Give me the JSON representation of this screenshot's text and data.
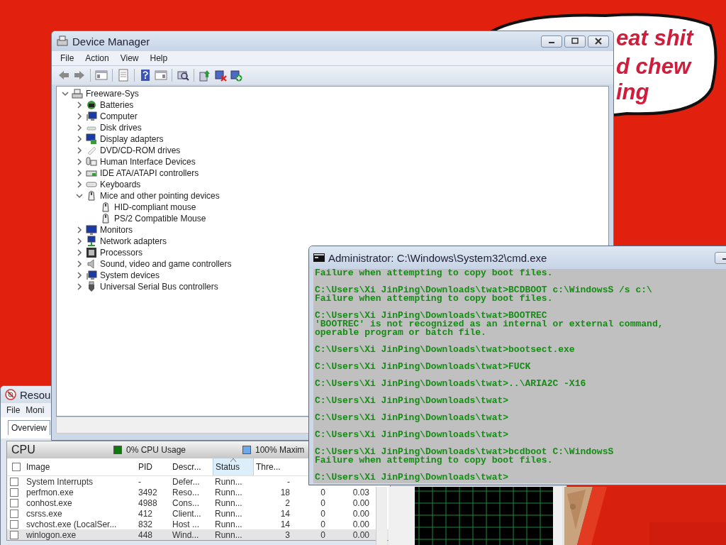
{
  "speech_bubble": {
    "lines": [
      "eat shit",
      "d chew",
      "ing"
    ]
  },
  "resource_monitor": {
    "title": "Resou",
    "menu": [
      "File",
      "Moni"
    ],
    "tabs": [
      {
        "label": "Overview",
        "selected": true
      }
    ],
    "cpu_panel": {
      "title": "CPU",
      "all_checked": false,
      "legend": [
        {
          "label": "0% CPU Usage",
          "color": "#0e7a0e"
        },
        {
          "label": "100% Maxim",
          "color": "#6aa8f0"
        }
      ],
      "columns": [
        {
          "label": "Image",
          "sorted": false
        },
        {
          "label": "PID",
          "sorted": false
        },
        {
          "label": "Descr...",
          "sorted": false
        },
        {
          "label": "Status",
          "sorted": true
        },
        {
          "label": "Thre...",
          "sorted": false
        }
      ],
      "rows": [
        {
          "checked": false,
          "selected": false,
          "cells": [
            "System Interrupts",
            "-",
            "Defer...",
            "Runn...",
            "-"
          ]
        },
        {
          "checked": false,
          "selected": false,
          "cells": [
            "perfmon.exe",
            "3492",
            "Reso...",
            "Runn...",
            "18",
            "0",
            "0.03"
          ]
        },
        {
          "checked": false,
          "selected": false,
          "cells": [
            "conhost.exe",
            "4988",
            "Cons...",
            "Runn...",
            "2",
            "0",
            "0.00"
          ]
        },
        {
          "checked": false,
          "selected": false,
          "cells": [
            "csrss.exe",
            "412",
            "Client...",
            "Runn...",
            "14",
            "0",
            "0.00"
          ]
        },
        {
          "checked": false,
          "selected": false,
          "cells": [
            "svchost.exe (LocalSer...",
            "832",
            "Host ...",
            "Runn...",
            "14",
            "0",
            "0.00"
          ]
        },
        {
          "checked": false,
          "selected": true,
          "cells": [
            "winlogon.exe",
            "448",
            "Wind...",
            "Runn...",
            "3",
            "0",
            "0.00"
          ]
        }
      ]
    }
  },
  "device_manager": {
    "title": "Device Manager",
    "menu": [
      "File",
      "Action",
      "View",
      "Help"
    ],
    "tree": [
      {
        "label": "Freeware-Sys",
        "kind": "host",
        "expanded": true,
        "children": [
          {
            "label": "Batteries",
            "kind": "battery",
            "expanded": false
          },
          {
            "label": "Computer",
            "kind": "computer",
            "expanded": false
          },
          {
            "label": "Disk drives",
            "kind": "disk",
            "expanded": false
          },
          {
            "label": "Display adapters",
            "kind": "display",
            "expanded": false
          },
          {
            "label": "DVD/CD-ROM drives",
            "kind": "dvd",
            "expanded": false
          },
          {
            "label": "Human Interface Devices",
            "kind": "hid",
            "expanded": false
          },
          {
            "label": "IDE ATA/ATAPI controllers",
            "kind": "ide",
            "expanded": false
          },
          {
            "label": "Keyboards",
            "kind": "keyboard",
            "expanded": false
          },
          {
            "label": "Mice and other pointing devices",
            "kind": "mouse",
            "expanded": true,
            "children": [
              {
                "label": "HID-compliant mouse",
                "kind": "mouse"
              },
              {
                "label": "PS/2 Compatible Mouse",
                "kind": "mouse"
              }
            ]
          },
          {
            "label": "Monitors",
            "kind": "monitor",
            "expanded": false
          },
          {
            "label": "Network adapters",
            "kind": "network",
            "expanded": false
          },
          {
            "label": "Processors",
            "kind": "processor",
            "expanded": false
          },
          {
            "label": "Sound, video and game controllers",
            "kind": "sound",
            "expanded": false
          },
          {
            "label": "System devices",
            "kind": "computer",
            "expanded": false
          },
          {
            "label": "Universal Serial Bus controllers",
            "kind": "usb",
            "expanded": false
          }
        ]
      }
    ]
  },
  "console": {
    "title": "Administrator: C:\\Windows\\System32\\cmd.exe",
    "blocks": [
      [
        "Failure when attempting to copy boot files."
      ],
      [
        "C:\\Users\\Xi JinPing\\Downloads\\twat>BCDBOOT c:\\WindowsS /s c:\\",
        "Failure when attempting to copy boot files."
      ],
      [
        "C:\\Users\\Xi JinPing\\Downloads\\twat>BOOTREC",
        "'BOOTREC' is not recognized as an internal or external command,",
        "operable program or batch file."
      ],
      [
        "C:\\Users\\Xi JinPing\\Downloads\\twat>bootsect.exe"
      ],
      [
        "C:\\Users\\Xi JinPing\\Downloads\\twat>FUCK"
      ],
      [
        "C:\\Users\\Xi JinPing\\Downloads\\twat>..\\ARIA2C -X16"
      ],
      [
        "C:\\Users\\Xi JinPing\\Downloads\\twat>"
      ],
      [
        "C:\\Users\\Xi JinPing\\Downloads\\twat>"
      ],
      [
        "C:\\Users\\Xi JinPing\\Downloads\\twat>"
      ],
      [
        "C:\\Users\\Xi JinPing\\Downloads\\twat>bcdboot C:\\WindowsS",
        "Failure when attempting to copy boot files."
      ],
      [
        "C:\\Users\\Xi JinPing\\Downloads\\twat>"
      ]
    ]
  }
}
